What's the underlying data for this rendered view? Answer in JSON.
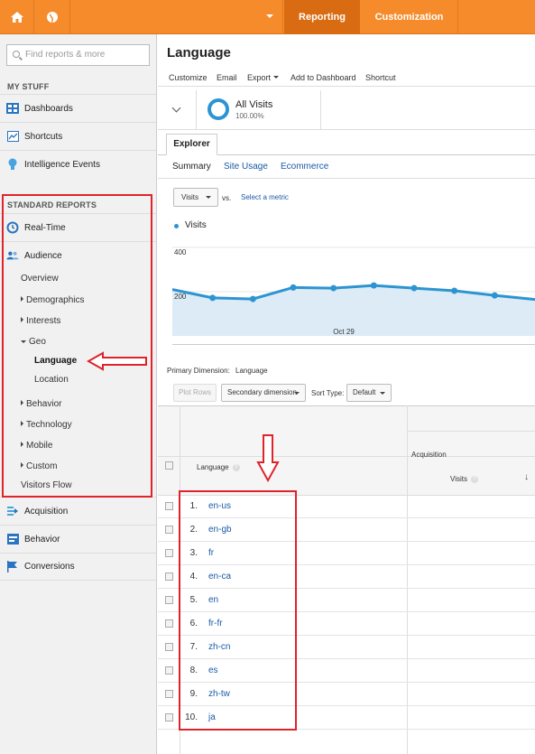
{
  "topbar": {
    "tabs": [
      {
        "label": "Reporting",
        "active": true
      },
      {
        "label": "Customization",
        "active": false
      }
    ],
    "accent": "#f58b2b"
  },
  "sidebar": {
    "search_placeholder": "Find reports & more",
    "my_stuff_label": "MY STUFF",
    "my_stuff": [
      {
        "label": "Dashboards",
        "icon": "dashboards-icon"
      },
      {
        "label": "Shortcuts",
        "icon": "shortcuts-icon"
      },
      {
        "label": "Intelligence Events",
        "icon": "lightbulb-icon"
      }
    ],
    "standard_reports_label": "STANDARD REPORTS",
    "realtime": "Real-Time",
    "audience": "Audience",
    "audience_items": {
      "overview": "Overview",
      "demographics": "Demographics",
      "interests": "Interests",
      "geo": "Geo",
      "language": "Language",
      "location": "Location",
      "behavior": "Behavior",
      "technology": "Technology",
      "mobile": "Mobile",
      "custom": "Custom",
      "visitors_flow": "Visitors Flow"
    },
    "bottom": [
      {
        "label": "Acquisition",
        "icon": "acquisition-icon"
      },
      {
        "label": "Behavior",
        "icon": "behavior-icon"
      },
      {
        "label": "Conversions",
        "icon": "flag-icon"
      }
    ]
  },
  "main": {
    "title": "Language",
    "toolbar": {
      "customize": "Customize",
      "email": "Email",
      "export": "Export",
      "add_dashboard": "Add to Dashboard",
      "shortcut": "Shortcut"
    },
    "segment": {
      "name": "All Visits",
      "pct": "100.00%"
    },
    "explorer_tab": "Explorer",
    "subtabs": {
      "summary": "Summary",
      "site_usage": "Site Usage",
      "ecommerce": "Ecommerce"
    },
    "metric_select": "Visits",
    "vs": "vs.",
    "select_metric": "Select a metric",
    "legend": "Visits",
    "primary_dimension_label": "Primary Dimension:",
    "primary_dimension_value": "Language",
    "plot_rows": "Plot Rows",
    "secondary_dimension": "Secondary dimension",
    "sort_type_label": "Sort Type:",
    "sort_type_value": "Default",
    "table": {
      "col_language": "Language",
      "group_acquisition": "Acquisition",
      "col_visits": "Visits",
      "rows": [
        {
          "num": "1.",
          "lang": "en-us"
        },
        {
          "num": "2.",
          "lang": "en-gb"
        },
        {
          "num": "3.",
          "lang": "fr"
        },
        {
          "num": "4.",
          "lang": "en-ca"
        },
        {
          "num": "5.",
          "lang": "en"
        },
        {
          "num": "6.",
          "lang": "fr-fr"
        },
        {
          "num": "7.",
          "lang": "zh-cn"
        },
        {
          "num": "8.",
          "lang": "es"
        },
        {
          "num": "9.",
          "lang": "zh-tw"
        },
        {
          "num": "10.",
          "lang": "ja"
        }
      ]
    }
  },
  "chart_data": {
    "type": "area",
    "series": [
      {
        "name": "Visits",
        "values": [
          210,
          172,
          167,
          219,
          216,
          228,
          216,
          204,
          183,
          165
        ]
      }
    ],
    "y_ticks": [
      "400",
      "200"
    ],
    "x_tick_label": "Oct 29",
    "ylim": [
      0,
      400
    ],
    "color": "#2d94d2"
  }
}
